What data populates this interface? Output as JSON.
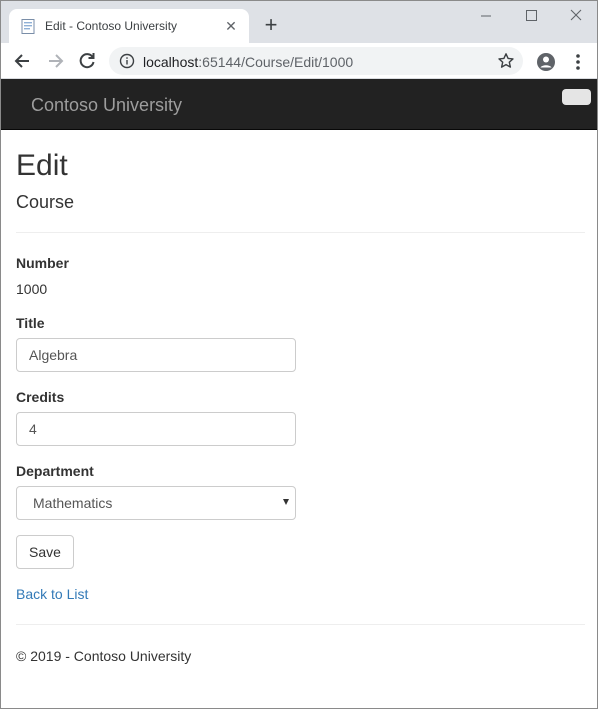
{
  "browser": {
    "tab_title": "Edit - Contoso University",
    "url_host": "localhost",
    "url_path": ":65144/Course/Edit/1000",
    "icons": {
      "favicon": "page-icon",
      "back": "arrow-left-icon",
      "forward": "arrow-right-icon",
      "reload": "reload-icon",
      "site_info": "info-icon",
      "bookmark": "star-icon",
      "profile": "account-circle-icon",
      "menu": "more-vert-icon",
      "new_tab": "plus-icon",
      "close_tab": "close-icon"
    },
    "window_controls": {
      "minimize": "—",
      "maximize": "☐",
      "close": "✕"
    },
    "tab_close_glyph": "✕",
    "new_tab_glyph": "+"
  },
  "navbar": {
    "brand": "Contoso University",
    "background": "#222222",
    "brand_color": "#9d9d9d"
  },
  "page": {
    "title": "Edit",
    "subtitle": "Course"
  },
  "form": {
    "number_label": "Number",
    "number_value": "1000",
    "title_label": "Title",
    "title_value": "Algebra",
    "credits_label": "Credits",
    "credits_value": "4",
    "department_label": "Department",
    "department_selected": "Mathematics",
    "save_label": "Save"
  },
  "links": {
    "back_to_list": "Back to List",
    "link_color": "#337ab7"
  },
  "footer": {
    "text": "© 2019 - Contoso University"
  }
}
